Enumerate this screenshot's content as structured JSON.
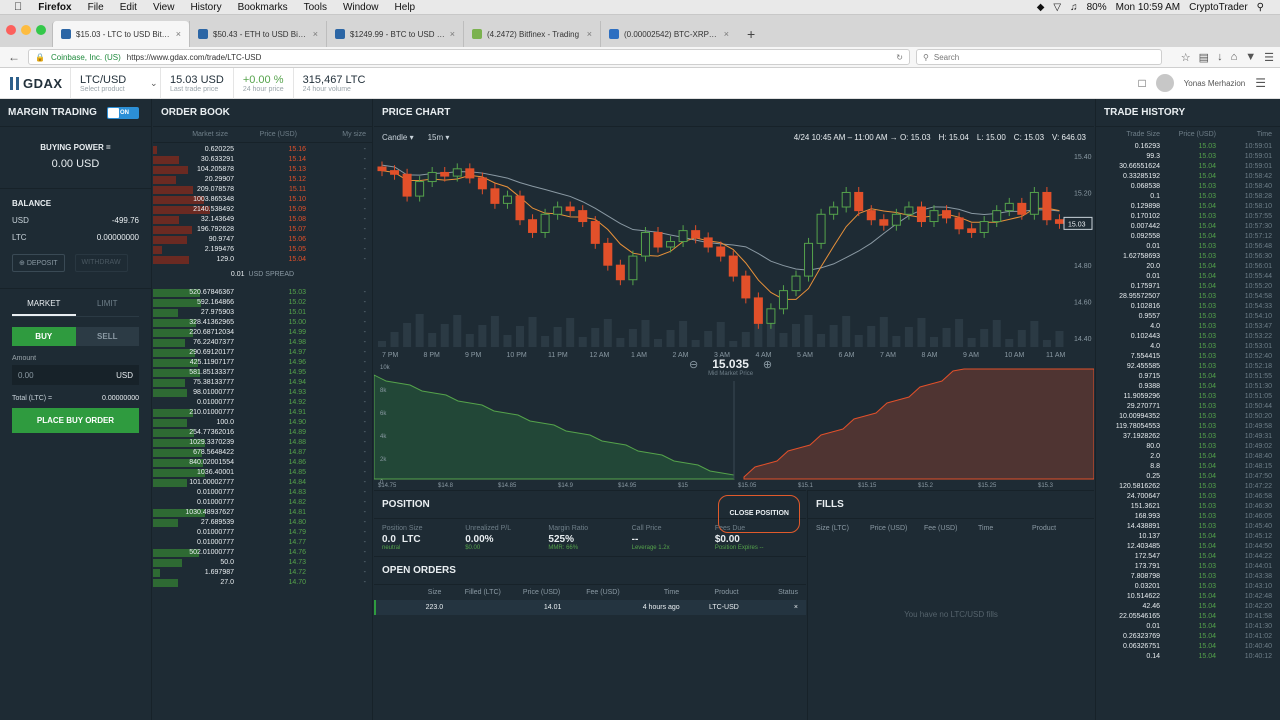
{
  "mac": {
    "app": "Firefox",
    "menus": [
      "File",
      "Edit",
      "View",
      "History",
      "Bookmarks",
      "Tools",
      "Window",
      "Help"
    ],
    "battery": "80%",
    "clock": "Mon 10:59 AM",
    "user": "CryptoTrader"
  },
  "tabs": [
    {
      "title": "$15.03 - LTC to USD Bitcoi...",
      "color": "#2c66a5",
      "active": true
    },
    {
      "title": "$50.43 - ETH to USD Bitcoi...",
      "color": "#2c66a5",
      "active": false
    },
    {
      "title": "$1249.99 - BTC to USD Bit...",
      "color": "#2c66a5",
      "active": false
    },
    {
      "title": "(4.2472) Bitfinex - Trading",
      "color": "#7bb24f",
      "active": false
    },
    {
      "title": "(0.00002542) BTC-XRP Ri...",
      "color": "#2d6fc1",
      "active": false
    }
  ],
  "url": {
    "site": "Coinbase, Inc. (US)",
    "address": "https://www.gdax.com/trade/LTC-USD"
  },
  "search_placeholder": "Search",
  "header": {
    "logo": "GDAX",
    "product": {
      "value": "LTC/USD",
      "label": "Select product"
    },
    "last_price": {
      "value": "15.03 USD",
      "label": "Last trade price"
    },
    "change": {
      "value": "+0.00 %",
      "label": "24 hour price"
    },
    "volume": {
      "value": "315,467 LTC",
      "label": "24 hour volume"
    },
    "user": "Yonas Merhazion"
  },
  "left": {
    "title": "MARGIN TRADING",
    "toggle": "ON",
    "buying_power_label": "BUYING POWER =",
    "buying_power": "0.00 USD",
    "balance_label": "BALANCE",
    "balances": [
      {
        "cur": "USD",
        "val": "-499.76"
      },
      {
        "cur": "LTC",
        "val": "0.00000000"
      }
    ],
    "deposit": "DEPOSIT",
    "withdraw": "WITHDRAW",
    "tab_market": "MARKET",
    "tab_limit": "LIMIT",
    "buy": "BUY",
    "sell": "SELL",
    "amount_label": "Amount",
    "amount_value": "0.00",
    "amount_unit": "USD",
    "total_label": "Total (LTC) =",
    "total_value": "0.00000000",
    "place": "PLACE BUY ORDER"
  },
  "book": {
    "title": "ORDER BOOK",
    "cols": [
      "Market size",
      "Price (USD)",
      "My size"
    ],
    "asks": [
      {
        "s": "0.620225",
        "p": "15.16"
      },
      {
        "s": "30.633291",
        "p": "15.14"
      },
      {
        "s": "104.205878",
        "p": "15.13"
      },
      {
        "s": "20.29907",
        "p": "15.12"
      },
      {
        "s": "209.078578",
        "p": "15.11"
      },
      {
        "s": "1003.865348",
        "p": "15.10"
      },
      {
        "s": "2140.538492",
        "p": "15.09"
      },
      {
        "s": "32.143649",
        "p": "15.08"
      },
      {
        "s": "196.792628",
        "p": "15.07"
      },
      {
        "s": "90.9747",
        "p": "15.06"
      },
      {
        "s": "2.199476",
        "p": "15.05"
      },
      {
        "s": "129.0",
        "p": "15.04"
      }
    ],
    "spread_val": "0.01",
    "spread_label": "USD SPREAD",
    "bids": [
      {
        "s": "520.67846367",
        "p": "15.03"
      },
      {
        "s": "592.164866",
        "p": "15.02"
      },
      {
        "s": "27.975903",
        "p": "15.01"
      },
      {
        "s": "328.41362965",
        "p": "15.00"
      },
      {
        "s": "220.68712034",
        "p": "14.99"
      },
      {
        "s": "76.22407377",
        "p": "14.98"
      },
      {
        "s": "290.69120177",
        "p": "14.97"
      },
      {
        "s": "425.11907177",
        "p": "14.96"
      },
      {
        "s": "581.85133377",
        "p": "14.95"
      },
      {
        "s": "75.38133777",
        "p": "14.94"
      },
      {
        "s": "98.01000777",
        "p": "14.93"
      },
      {
        "s": "0.01000777",
        "p": "14.92"
      },
      {
        "s": "210.01000777",
        "p": "14.91"
      },
      {
        "s": "100.0",
        "p": "14.90"
      },
      {
        "s": "254.77362016",
        "p": "14.89"
      },
      {
        "s": "1029.3370239",
        "p": "14.88"
      },
      {
        "s": "678.5648422",
        "p": "14.87"
      },
      {
        "s": "840.02001554",
        "p": "14.86"
      },
      {
        "s": "1036.40001",
        "p": "14.85"
      },
      {
        "s": "101.00002777",
        "p": "14.84"
      },
      {
        "s": "0.01000777",
        "p": "14.83"
      },
      {
        "s": "0.01000777",
        "p": "14.82"
      },
      {
        "s": "1030.48937627",
        "p": "14.81"
      },
      {
        "s": "27.689539",
        "p": "14.80"
      },
      {
        "s": "0.01000777",
        "p": "14.79"
      },
      {
        "s": "0.01000777",
        "p": "14.77"
      },
      {
        "s": "502.01000777",
        "p": "14.76"
      },
      {
        "s": "50.0",
        "p": "14.73"
      },
      {
        "s": "1.697987",
        "p": "14.72"
      },
      {
        "s": "27.0",
        "p": "14.70"
      }
    ]
  },
  "chart": {
    "title": "PRICE CHART",
    "type": "Candle",
    "interval": "15m",
    "range": "4/24 10:45 AM – 11:00 AM → O: 15.03",
    "h": "H: 15.04",
    "l": "L: 15.00",
    "c": "C: 15.03",
    "v": "V: 646.03",
    "xticks": [
      "7 PM",
      "8 PM",
      "9 PM",
      "10 PM",
      "11 PM",
      "12 AM",
      "1 AM",
      "2 AM",
      "3 AM",
      "4 AM",
      "5 AM",
      "6 AM",
      "7 AM",
      "8 AM",
      "9 AM",
      "10 AM",
      "11 AM"
    ],
    "yticks": [
      "15.40",
      "15.20",
      "14.80",
      "14.60",
      "14.40"
    ],
    "last": "15.03",
    "mid": "15.035",
    "mid_label": "Mid Market Price",
    "depth_x": [
      "$14.75",
      "$14.8",
      "$14.85",
      "$14.9",
      "$14.95",
      "$15",
      "$15.05",
      "$15.1",
      "$15.15",
      "$15.2",
      "$15.25",
      "$15.3"
    ],
    "depth_y": [
      "10k",
      "8k",
      "6k",
      "4k",
      "2k",
      "0"
    ]
  },
  "chart_data": {
    "type": "candlestick",
    "closes": [
      15.32,
      15.3,
      15.18,
      15.26,
      15.31,
      15.29,
      15.33,
      15.28,
      15.22,
      15.14,
      15.18,
      15.05,
      14.98,
      15.08,
      15.12,
      15.1,
      15.04,
      14.92,
      14.8,
      14.72,
      14.85,
      14.98,
      14.9,
      14.93,
      14.99,
      14.95,
      14.9,
      14.85,
      14.74,
      14.62,
      14.48,
      14.56,
      14.66,
      14.74,
      14.92,
      15.08,
      15.12,
      15.2,
      15.1,
      15.05,
      15.02,
      15.08,
      15.12,
      15.04,
      15.1,
      15.06,
      15.0,
      14.98,
      15.04,
      15.1,
      15.14,
      15.08,
      15.2,
      15.05,
      15.03
    ]
  },
  "position": {
    "title": "POSITION",
    "close": "CLOSE POSITION",
    "cells": [
      {
        "l": "Position Size",
        "v": "0.0",
        "u": "LTC",
        "s": "neutral"
      },
      {
        "l": "Unrealized P/L",
        "v": "0.00%",
        "u": "",
        "s": "$0.00"
      },
      {
        "l": "Margin Ratio",
        "v": "525%",
        "u": "",
        "s": "MMR: 66%"
      },
      {
        "l": "Call Price",
        "v": "--",
        "u": "",
        "s": "Leverage 1.2x"
      },
      {
        "l": "Fees Due",
        "v": "$0.00",
        "u": "",
        "s": "Position Expires --"
      }
    ]
  },
  "orders": {
    "title": "OPEN ORDERS",
    "cols": [
      "Size",
      "Filled (LTC)",
      "Price (USD)",
      "Fee (USD)",
      "Time",
      "Product",
      "Status"
    ],
    "row": [
      "223.0",
      "",
      "14.01",
      "",
      "4 hours ago",
      "LTC-USD",
      "×"
    ]
  },
  "fills": {
    "title": "FILLS",
    "cols": [
      "Size (LTC)",
      "Price (USD)",
      "Fee (USD)",
      "Time",
      "Product"
    ],
    "empty": "You have no LTC/USD fills"
  },
  "history": {
    "title": "TRADE HISTORY",
    "cols": [
      "Trade Size",
      "Price (USD)",
      "Time"
    ],
    "rows": [
      {
        "s": "0.16293",
        "p": "15.03",
        "t": "10:59:01"
      },
      {
        "s": "99.3",
        "p": "15.03",
        "t": "10:59:01"
      },
      {
        "s": "30.66551624",
        "p": "15.04",
        "t": "10:59:01"
      },
      {
        "s": "0.33285192",
        "p": "15.04",
        "t": "10:58:42"
      },
      {
        "s": "0.068538",
        "p": "15.03",
        "t": "10:58:40"
      },
      {
        "s": "0.1",
        "p": "15.03",
        "t": "10:58:28"
      },
      {
        "s": "0.129898",
        "p": "15.04",
        "t": "10:58:10"
      },
      {
        "s": "0.170102",
        "p": "15.03",
        "t": "10:57:55"
      },
      {
        "s": "0.007442",
        "p": "15.04",
        "t": "10:57:30"
      },
      {
        "s": "0.092558",
        "p": "15.04",
        "t": "10:57:12"
      },
      {
        "s": "0.01",
        "p": "15.03",
        "t": "10:56:48"
      },
      {
        "s": "1.62758693",
        "p": "15.03",
        "t": "10:56:30"
      },
      {
        "s": "20.0",
        "p": "15.04",
        "t": "10:56:01"
      },
      {
        "s": "0.01",
        "p": "15.04",
        "t": "10:55:44"
      },
      {
        "s": "0.175971",
        "p": "15.04",
        "t": "10:55:20"
      },
      {
        "s": "28.95572507",
        "p": "15.03",
        "t": "10:54:58"
      },
      {
        "s": "0.102816",
        "p": "15.03",
        "t": "10:54:33"
      },
      {
        "s": "0.9557",
        "p": "15.03",
        "t": "10:54:10"
      },
      {
        "s": "4.0",
        "p": "15.03",
        "t": "10:53:47"
      },
      {
        "s": "0.102443",
        "p": "15.03",
        "t": "10:53:22"
      },
      {
        "s": "4.0",
        "p": "15.03",
        "t": "10:53:01"
      },
      {
        "s": "7.554415",
        "p": "15.03",
        "t": "10:52:40"
      },
      {
        "s": "92.455585",
        "p": "15.03",
        "t": "10:52:18"
      },
      {
        "s": "0.9715",
        "p": "15.04",
        "t": "10:51:55"
      },
      {
        "s": "0.9388",
        "p": "15.04",
        "t": "10:51:30"
      },
      {
        "s": "11.9059296",
        "p": "15.03",
        "t": "10:51:05"
      },
      {
        "s": "29.270771",
        "p": "15.03",
        "t": "10:50:44"
      },
      {
        "s": "10.00994352",
        "p": "15.03",
        "t": "10:50:20"
      },
      {
        "s": "119.78054553",
        "p": "15.03",
        "t": "10:49:58"
      },
      {
        "s": "37.1928262",
        "p": "15.03",
        "t": "10:49:31"
      },
      {
        "s": "80.0",
        "p": "15.03",
        "t": "10:49:02"
      },
      {
        "s": "2.0",
        "p": "15.04",
        "t": "10:48:40"
      },
      {
        "s": "8.8",
        "p": "15.04",
        "t": "10:48:15"
      },
      {
        "s": "0.25",
        "p": "15.04",
        "t": "10:47:50"
      },
      {
        "s": "120.5816262",
        "p": "15.03",
        "t": "10:47:22"
      },
      {
        "s": "24.700647",
        "p": "15.03",
        "t": "10:46:58"
      },
      {
        "s": "151.3621",
        "p": "15.03",
        "t": "10:46:30"
      },
      {
        "s": "168.993",
        "p": "15.03",
        "t": "10:46:05"
      },
      {
        "s": "14.438891",
        "p": "15.03",
        "t": "10:45:40"
      },
      {
        "s": "10.137",
        "p": "15.04",
        "t": "10:45:12"
      },
      {
        "s": "12.403485",
        "p": "15.04",
        "t": "10:44:50"
      },
      {
        "s": "172.547",
        "p": "15.04",
        "t": "10:44:22"
      },
      {
        "s": "173.791",
        "p": "15.03",
        "t": "10:44:01"
      },
      {
        "s": "7.808798",
        "p": "15.03",
        "t": "10:43:38"
      },
      {
        "s": "0.03201",
        "p": "15.03",
        "t": "10:43:10"
      },
      {
        "s": "10.514622",
        "p": "15.04",
        "t": "10:42:48"
      },
      {
        "s": "42.46",
        "p": "15.04",
        "t": "10:42:20"
      },
      {
        "s": "22.05546165",
        "p": "15.04",
        "t": "10:41:58"
      },
      {
        "s": "0.01",
        "p": "15.04",
        "t": "10:41:30"
      },
      {
        "s": "0.26323769",
        "p": "15.04",
        "t": "10:41:02"
      },
      {
        "s": "0.06326751",
        "p": "15.04",
        "t": "10:40:40"
      },
      {
        "s": "0.14",
        "p": "15.04",
        "t": "10:40:12"
      }
    ]
  },
  "colors": {
    "green": "#55a34b",
    "red": "#e2502a",
    "bg": "#1e2b34"
  }
}
